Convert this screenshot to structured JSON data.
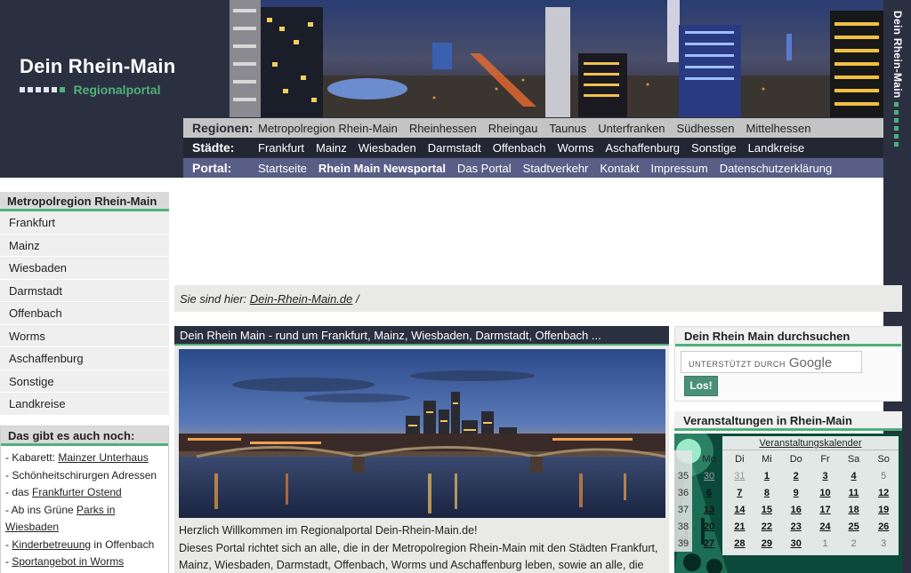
{
  "logo": {
    "title": "Dein Rhein-Main",
    "subtitle": "Regionalportal"
  },
  "nav": {
    "regionen": {
      "label": "Regionen:",
      "items": [
        "Metropolregion Rhein-Main",
        "Rheinhessen",
        "Rheingau",
        "Taunus",
        "Unterfranken",
        "Südhessen",
        "Mittelhessen"
      ]
    },
    "staedte": {
      "label": "Städte:",
      "items": [
        "Frankfurt",
        "Mainz",
        "Wiesbaden",
        "Darmstadt",
        "Offenbach",
        "Worms",
        "Aschaffenburg",
        "Sonstige",
        "Landkreise"
      ]
    },
    "portal": {
      "label": "Portal:",
      "items": [
        "Startseite",
        "Rhein Main Newsportal",
        "Das Portal",
        "Stadtverkehr",
        "Kontakt",
        "Impressum",
        "Datenschutzerklärung"
      ]
    }
  },
  "vertical_title": "Dein Rhein-Main",
  "sidebar": {
    "title": "Metropolregion Rhein-Main",
    "items": [
      "Frankfurt",
      "Mainz",
      "Wiesbaden",
      "Darmstadt",
      "Offenbach",
      "Worms",
      "Aschaffenburg",
      "Sonstige",
      "Landkreise"
    ]
  },
  "extras": {
    "title": "Das gibt es auch noch:",
    "items": [
      {
        "pre": "- Kabarett: ",
        "link": "Mainzer Unterhaus",
        "post": ""
      },
      {
        "pre": "- Schönheitschirurgen Adressen",
        "link": "",
        "post": ""
      },
      {
        "pre": "- das ",
        "link": "Frankfurter Ostend",
        "post": ""
      },
      {
        "pre": "- Ab ins Grüne ",
        "link": "Parks in Wiesbaden",
        "post": ""
      },
      {
        "pre": "- ",
        "link": "Kinderbetreuung",
        "post": " in Offenbach"
      },
      {
        "pre": "- ",
        "link": "Sportangebot in Worms",
        "post": ""
      }
    ]
  },
  "breadcrumb": {
    "prefix": "Sie sind hier: ",
    "link": "Dein-Rhein-Main.de",
    "suffix": " /"
  },
  "main": {
    "heading": "Dein Rhein Main - rund um Frankfurt, Mainz, Wiesbaden, Darmstadt, Offenbach ...",
    "welcome": "Herzlich Willkommen im Regionalportal Dein-Rhein-Main.de!",
    "intro": "Dieses Portal richtet sich an alle, die in der Metropolregion Rhein-Main mit den Städten Frankfurt, Mainz, Wiesbaden, Darmstadt, Offenbach, Worms und Aschaffenburg leben, sowie an alle, die"
  },
  "search": {
    "title": "Dein Rhein Main durchsuchen",
    "powered": "UNTERSTÜTZT DURCH",
    "google": "Google",
    "button": "Los!"
  },
  "events": {
    "title": "Veranstaltungen in Rhein-Main",
    "calendar_title": "Veranstaltungskalender",
    "weekdays": [
      "Mo",
      "Di",
      "Mi",
      "Do",
      "Fr",
      "Sa",
      "So"
    ],
    "weeks": [
      {
        "wk": "35",
        "days": [
          [
            "30",
            "o"
          ],
          [
            "31",
            "o"
          ],
          [
            "1",
            "d"
          ],
          [
            "2",
            "d"
          ],
          [
            "3",
            "d"
          ],
          [
            "4",
            "d"
          ],
          [
            "5",
            "p"
          ]
        ]
      },
      {
        "wk": "36",
        "days": [
          [
            "6",
            "d"
          ],
          [
            "7",
            "d"
          ],
          [
            "8",
            "d"
          ],
          [
            "9",
            "d"
          ],
          [
            "10",
            "d"
          ],
          [
            "11",
            "d"
          ],
          [
            "12",
            "d"
          ]
        ]
      },
      {
        "wk": "37",
        "days": [
          [
            "13",
            "d"
          ],
          [
            "14",
            "d"
          ],
          [
            "15",
            "d"
          ],
          [
            "16",
            "d"
          ],
          [
            "17",
            "d"
          ],
          [
            "18",
            "d"
          ],
          [
            "19",
            "d"
          ]
        ]
      },
      {
        "wk": "38",
        "days": [
          [
            "20",
            "d"
          ],
          [
            "21",
            "d"
          ],
          [
            "22",
            "d"
          ],
          [
            "23",
            "d"
          ],
          [
            "24",
            "d"
          ],
          [
            "25",
            "d"
          ],
          [
            "26",
            "d"
          ]
        ]
      },
      {
        "wk": "39",
        "days": [
          [
            "27",
            "d"
          ],
          [
            "28",
            "d"
          ],
          [
            "29",
            "d"
          ],
          [
            "30",
            "d"
          ],
          [
            "1",
            "pl"
          ],
          [
            "2",
            "pl"
          ],
          [
            "3",
            "pl"
          ]
        ]
      }
    ]
  },
  "colors": {
    "accent": "#4fb07c",
    "dark": "#2b3040",
    "portal_bar": "#595e87",
    "regionen_bar": "#c4c4c4"
  }
}
